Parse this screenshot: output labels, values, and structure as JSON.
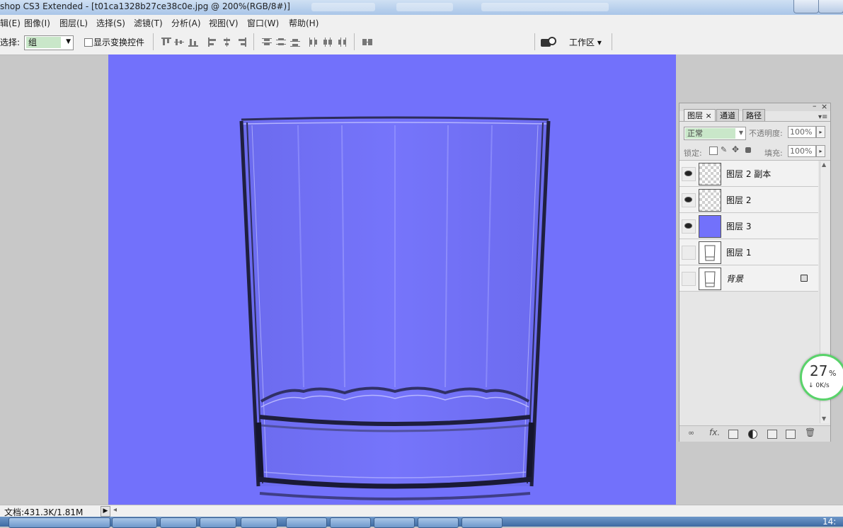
{
  "window": {
    "title": "shop CS3 Extended - [t01ca1328b27ce38c0e.jpg @ 200%(RGB/8#)]"
  },
  "menubar": {
    "items": [
      "辑(E)",
      "图像(I)",
      "图层(L)",
      "选择(S)",
      "滤镜(T)",
      "分析(A)",
      "视图(V)",
      "窗口(W)",
      "帮助(H)"
    ]
  },
  "options": {
    "select_label": "选择:",
    "select_value": "组",
    "transform_label": "显示变换控件",
    "workspace_label": "工作区 ▾"
  },
  "canvas": {
    "fill_color": "#7271fb",
    "content": "glass-tumbler"
  },
  "layers_panel": {
    "tabs": [
      {
        "label": "图层 ×",
        "active": true
      },
      {
        "label": "通道",
        "active": false
      },
      {
        "label": "路径",
        "active": false
      }
    ],
    "blend_mode": "正常",
    "opacity_label": "不透明度:",
    "opacity_value": "100%",
    "lock_label": "锁定:",
    "fill_label": "填充:",
    "fill_value": "100%",
    "layers": [
      {
        "name": "图层 2 副本",
        "visible": true,
        "thumb": "checker"
      },
      {
        "name": "图层 2",
        "visible": true,
        "thumb": "checker"
      },
      {
        "name": "图层 3",
        "visible": true,
        "thumb": "blue"
      },
      {
        "name": "图层 1",
        "visible": false,
        "thumb": "glass"
      },
      {
        "name": "背景",
        "visible": false,
        "thumb": "glass",
        "locked": true
      }
    ]
  },
  "speed_meter": {
    "percent": "27",
    "percent_sign": "%",
    "rate": "↓ 0K/s"
  },
  "statusbar": {
    "doc_info": "文档:431.3K/1.81M"
  },
  "taskbar": {
    "clock": "14:"
  }
}
